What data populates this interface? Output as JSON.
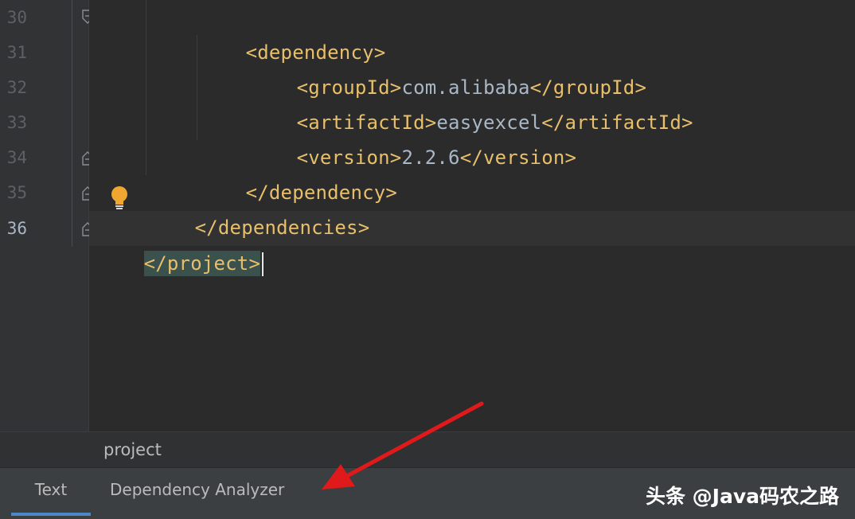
{
  "gutter": {
    "line_numbers": [
      "30",
      "31",
      "32",
      "33",
      "34",
      "35",
      "36"
    ],
    "active_line": "36"
  },
  "code": {
    "lines": [
      {
        "open": "<dependency>",
        "text": "",
        "close": ""
      },
      {
        "open": "<groupId>",
        "text": "com.alibaba",
        "close": "</groupId>"
      },
      {
        "open": "<artifactId>",
        "text": "easyexcel",
        "close": "</artifactId>"
      },
      {
        "open": "<version>",
        "text": "2.2.6",
        "close": "</version>"
      },
      {
        "open": "</dependency>",
        "text": "",
        "close": ""
      },
      {
        "open": "</dependencies>",
        "text": "",
        "close": ""
      },
      {
        "open": "</project>",
        "text": "",
        "close": ""
      }
    ]
  },
  "breadcrumb": {
    "item": "project"
  },
  "tabs": {
    "text": "Text",
    "dependency_analyzer": "Dependency Analyzer",
    "active": "Text"
  },
  "watermark": "头条 @Java码农之路",
  "colors": {
    "background": "#2b2b2b",
    "tag": "#e8bf6a",
    "text": "#a9b7c6",
    "accent": "#4a88c7",
    "arrow": "#e0191b"
  },
  "icons": [
    "fold-icon",
    "intention-bulb-icon",
    "annotation-arrow"
  ]
}
